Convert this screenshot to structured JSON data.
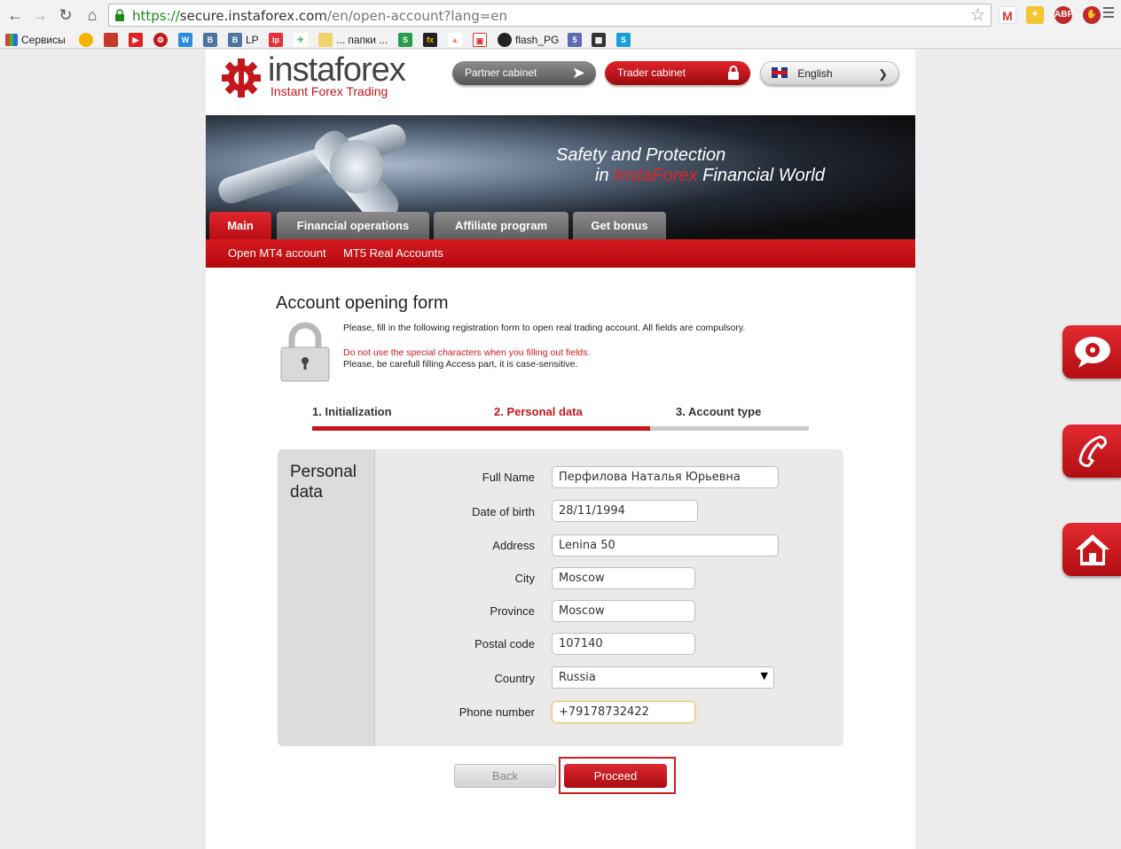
{
  "browser": {
    "url_scheme": "https://",
    "url_host": "secure.instaforex.com",
    "url_path": "/en/open-account?lang=en",
    "extensions": [
      "gmail-icon",
      "notes-icon",
      "adblock-icon",
      "stop-icon"
    ],
    "ext_abp_label": "ABP",
    "bookmarks": {
      "apps": "Сервисы",
      "b1": "В",
      "b2": "В",
      "lp": "LP",
      "folder": "... папки ...",
      "github": "flash_PG"
    }
  },
  "header": {
    "logo_text": "instaforex",
    "logo_subtitle": "Instant Forex Trading",
    "partner_label": "Partner cabinet",
    "trader_label": "Trader cabinet",
    "language": "English"
  },
  "banner": {
    "line1": "Safety and Protection",
    "line2_prefix": "in ",
    "line2_brand": "InstaForex",
    "line2_suffix": " Financial World"
  },
  "nav": {
    "tabs": [
      "Main",
      "Financial operations",
      "Affiliate program",
      "Get bonus"
    ],
    "subnav": [
      "Open MT4 account",
      "MT5 Real Accounts"
    ]
  },
  "form": {
    "title": "Account opening form",
    "intro": "Please, fill in the following registration form to open real trading account. All fields are compulsory.",
    "warning": "Do not use the special characters when you filling out fields.",
    "note": "Please, be carefull filling Access part, it is case-sensitive.",
    "steps": [
      "1. Initialization",
      "2. Personal data",
      "3. Account type"
    ],
    "active_step": 2,
    "progress": 0.68,
    "section_title": "Personal data",
    "fields": {
      "full_name": {
        "label": "Full Name",
        "value": "Перфилова Наталья Юрьевна"
      },
      "dob": {
        "label": "Date of birth",
        "value": "28/11/1994"
      },
      "address": {
        "label": "Address",
        "value": "Lenina 50"
      },
      "city": {
        "label": "City",
        "value": "Moscow"
      },
      "province": {
        "label": "Province",
        "value": "Moscow"
      },
      "postal": {
        "label": "Postal code",
        "value": "107140"
      },
      "country": {
        "label": "Country",
        "value": "Russia"
      },
      "phone": {
        "label": "Phone number",
        "value": "+79178732422"
      }
    },
    "back_label": "Back",
    "proceed_label": "Proceed"
  },
  "colors": {
    "brand_red": "#c4161c",
    "gray_tab": "#6f6f6f"
  }
}
